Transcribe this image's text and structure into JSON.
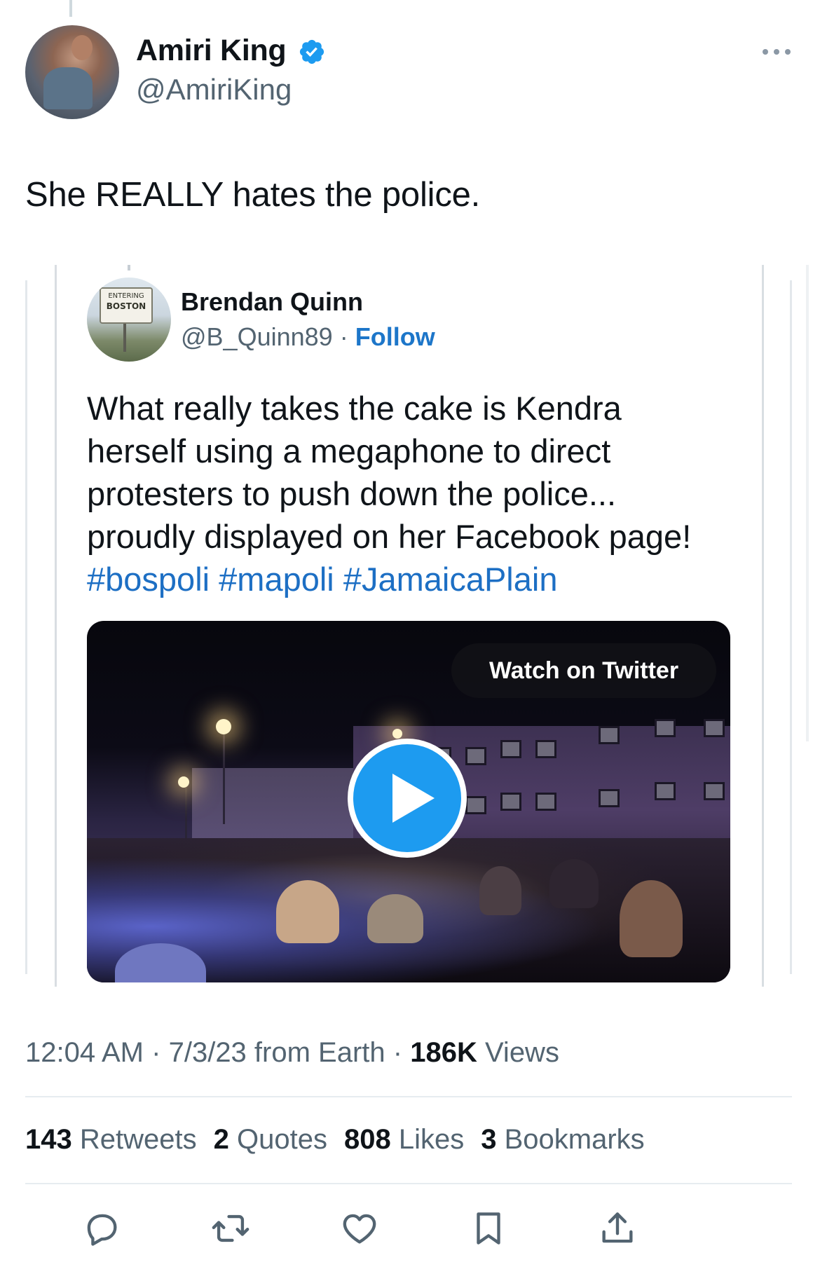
{
  "author": {
    "name": "Amiri King",
    "handle": "@AmiriKing",
    "verified_icon": "verified-badge-icon",
    "more_icon": "more-options-icon"
  },
  "tweet": {
    "text": "She REALLY hates the police."
  },
  "quoted_tweet": {
    "author_name": "Brendan Quinn",
    "author_handle": "@B_Quinn89",
    "separator": "·",
    "follow_label": "Follow",
    "avatar_sign": {
      "top": "ENTERING",
      "bottom": "BOSTON"
    },
    "text_lines": [
      "What really takes the cake is Kendra",
      "herself using a megaphone to direct",
      "protesters to push down the police...",
      "proudly displayed on her Facebook page!"
    ],
    "hashtags": [
      "#bospoli",
      "#mapoli",
      "#JamaicaPlain"
    ],
    "video": {
      "watch_label": "Watch on Twitter",
      "play_icon": "play-icon"
    }
  },
  "meta": {
    "time": "12:04 AM",
    "separator": "·",
    "date_source": "7/3/23 from Earth",
    "views_count": "186K",
    "views_label": "Views"
  },
  "stats": {
    "retweets_count": "143",
    "retweets_label": "Retweets",
    "quotes_count": "2",
    "quotes_label": "Quotes",
    "likes_count": "808",
    "likes_label": "Likes",
    "bookmarks_count": "3",
    "bookmarks_label": "Bookmarks"
  },
  "actions": [
    "reply-icon",
    "retweet-icon",
    "like-icon",
    "bookmark-icon",
    "share-icon"
  ],
  "colors": {
    "text_primary": "#0f1419",
    "text_secondary": "#536471",
    "link": "#1d76c9",
    "accent": "#1d9bf0",
    "divider": "#e6ecf0"
  }
}
